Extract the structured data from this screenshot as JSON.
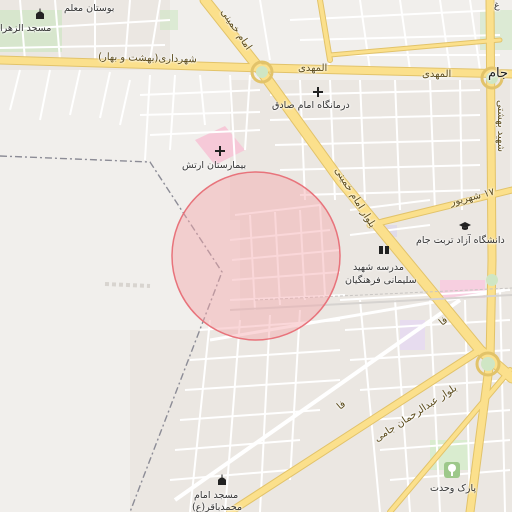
{
  "map": {
    "colors": {
      "background": "#f1efec",
      "major_road": "#fbe08c",
      "major_road_casing": "#e2c36a",
      "minor_road": "#ffffff",
      "area_circle_fill": "#f4a6aa",
      "area_circle_stroke": "#e8737b",
      "park": "#cfe6c4",
      "hospital": "#f6c9d8",
      "boundary": "#8c8c96"
    },
    "labels": {
      "park_moallem": "بوستان معلم",
      "mosque_zahra": "مسجد الزهرا",
      "road_shahrdari": "شهرداری(بهشت و بهار)",
      "road_almahdi_1": "المهدی",
      "road_almahdi_2": "المهدی",
      "clinic_imam_sadegh": "درمانگاه امام صادق",
      "hospital_artesh": "بیمارستان ارتش",
      "road_imam_khomeini_1": "امام خمینی",
      "road_imam_khomeini_2": "بلوار امام خمینی",
      "road_17_shahrivar": "۱۷ شهریور",
      "university_azad": "دانشگاه آزاد تربت جام",
      "school_soleimani_1": "مدرسه شهید",
      "school_soleimani_2": "سلیمانی فرهنگیان",
      "road_shahid_beheshti": "شهید بهشتی",
      "road_fa_1": "فا",
      "road_fa_2": "فا",
      "road_abdolrahman_jami": "بلوار عبدالرحمان جامی",
      "mosque_imam_1": "مسجد امام",
      "mosque_imam_2": "محمدباقر(ع)",
      "park_vahdat": "پارک وحدت",
      "city_jam": "جام",
      "edge_top_right": "غ"
    },
    "icons": {
      "hospital": "cross-icon",
      "clinic": "cross-icon",
      "mosque": "mosque-icon",
      "university": "graduation-cap-icon",
      "school": "school-icon",
      "park": "tree-icon"
    }
  }
}
